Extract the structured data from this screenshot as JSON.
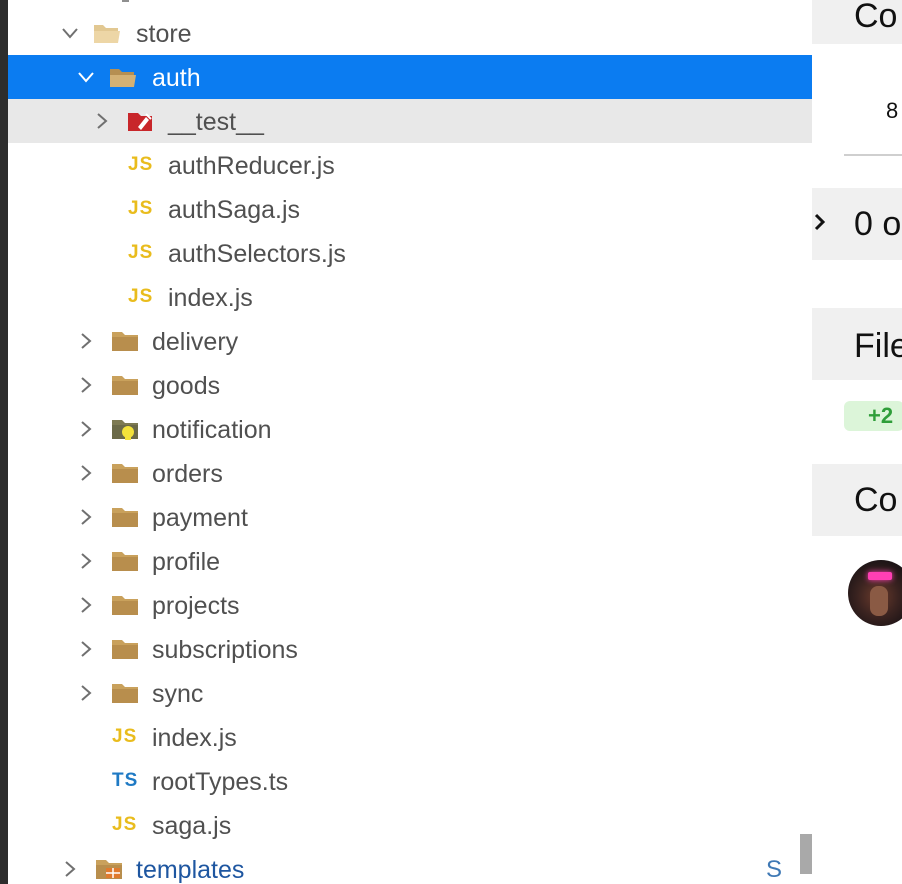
{
  "explorer": {
    "items": [
      {
        "label": "store",
        "kind": "folder-open",
        "expanded": true
      },
      {
        "label": "auth",
        "kind": "folder-open",
        "expanded": true,
        "selected": true
      },
      {
        "label": "__test__",
        "kind": "folder-test",
        "expanded": false
      },
      {
        "label": "authReducer.js",
        "kind": "js",
        "icon_text": "JS"
      },
      {
        "label": "authSaga.js",
        "kind": "js",
        "icon_text": "JS"
      },
      {
        "label": "authSelectors.js",
        "kind": "js",
        "icon_text": "JS"
      },
      {
        "label": "index.js",
        "kind": "js",
        "icon_text": "JS"
      },
      {
        "label": "delivery",
        "kind": "folder",
        "expanded": false
      },
      {
        "label": "goods",
        "kind": "folder",
        "expanded": false
      },
      {
        "label": "notification",
        "kind": "folder-notification",
        "expanded": false
      },
      {
        "label": "orders",
        "kind": "folder",
        "expanded": false
      },
      {
        "label": "payment",
        "kind": "folder",
        "expanded": false
      },
      {
        "label": "profile",
        "kind": "folder",
        "expanded": false
      },
      {
        "label": "projects",
        "kind": "folder",
        "expanded": false
      },
      {
        "label": "subscriptions",
        "kind": "folder",
        "expanded": false
      },
      {
        "label": "sync",
        "kind": "folder",
        "expanded": false
      },
      {
        "label": "index.js",
        "kind": "js",
        "icon_text": "JS"
      },
      {
        "label": "rootTypes.ts",
        "kind": "ts",
        "icon_text": "TS"
      },
      {
        "label": "saga.js",
        "kind": "js",
        "icon_text": "JS"
      },
      {
        "label": "templates",
        "kind": "folder-templates",
        "expanded": false,
        "git_status": "S"
      }
    ]
  },
  "right_panel": {
    "section1_title": "Co",
    "section1_value": "8",
    "section2_title": "0 o",
    "section3_title": "File",
    "badge": "+2",
    "section4_title": "Co"
  },
  "colors": {
    "selection": "#0b7cf1",
    "hover": "#e8e8e8",
    "folder": "#c9a15c",
    "js": "#e9bc1d",
    "ts": "#1f7ac4",
    "test_folder": "#c8262a",
    "git_untracked": "#3f79b5"
  }
}
